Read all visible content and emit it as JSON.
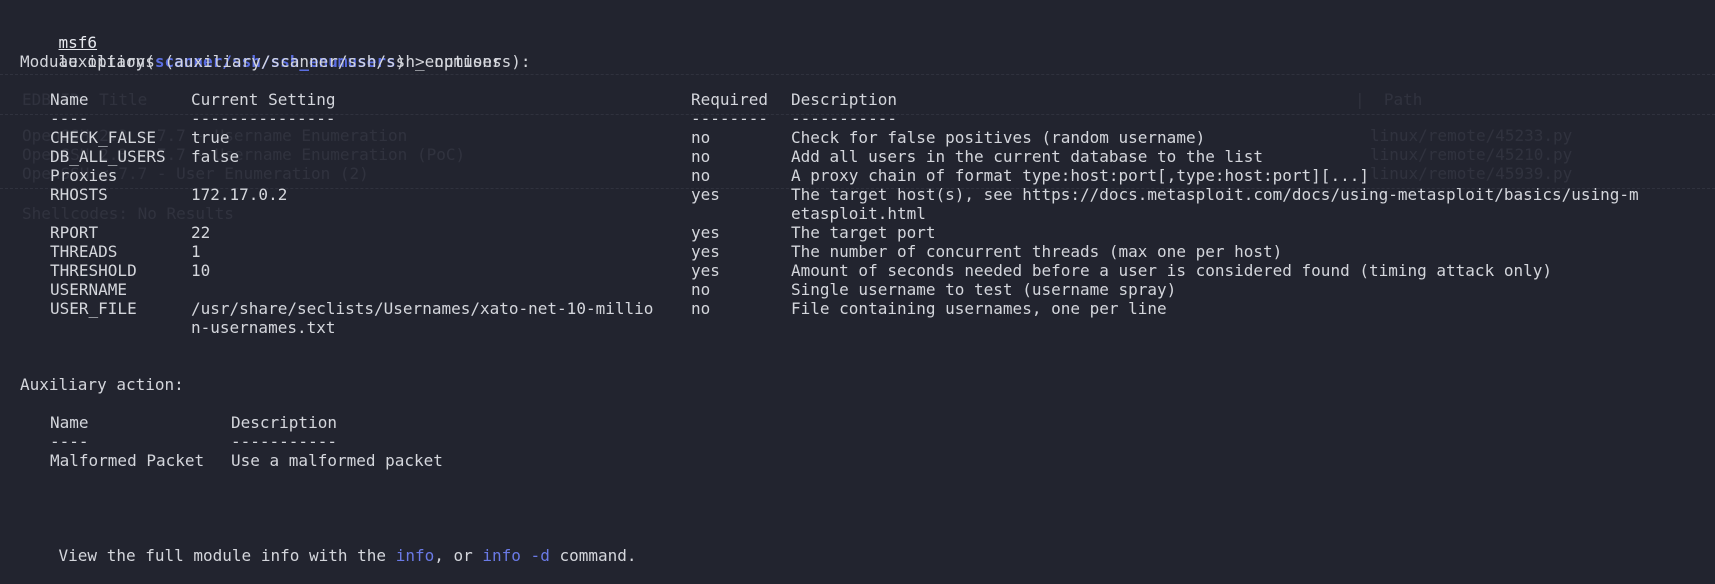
{
  "prompt": {
    "msf": "msf6",
    "module_type": "auxiliary",
    "open_paren": "(",
    "module_path": "scanner/ssh/ssh_enumusers",
    "close": ") > ",
    "command": "options"
  },
  "module_options": {
    "heading": "Module options (auxiliary/scanner/ssh/ssh_enumusers):",
    "headers": {
      "name": "Name",
      "setting": "Current Setting",
      "required": "Required",
      "description": "Description"
    },
    "underlines": {
      "name": "----",
      "setting": "---------------",
      "required": "--------",
      "description": "-----------"
    },
    "rows": [
      {
        "name": "CHECK_FALSE",
        "setting": "true",
        "required": "no",
        "description": "Check for false positives (random username)"
      },
      {
        "name": "DB_ALL_USERS",
        "setting": "false",
        "required": "no",
        "description": "Add all users in the current database to the list"
      },
      {
        "name": "Proxies",
        "setting": "",
        "required": "no",
        "description": "A proxy chain of format type:host:port[,type:host:port][...]"
      },
      {
        "name": "RHOSTS",
        "setting": "172.17.0.2",
        "required": "yes",
        "description": "The target host(s), see https://docs.metasploit.com/docs/using-metasploit/basics/using-m",
        "description_cont": "etasploit.html"
      },
      {
        "name": "RPORT",
        "setting": "22",
        "required": "yes",
        "description": "The target port"
      },
      {
        "name": "THREADS",
        "setting": "1",
        "required": "yes",
        "description": "The number of concurrent threads (max one per host)"
      },
      {
        "name": "THRESHOLD",
        "setting": "10",
        "required": "yes",
        "description": "Amount of seconds needed before a user is considered found (timing attack only)"
      },
      {
        "name": "USERNAME",
        "setting": "",
        "required": "no",
        "description": "Single username to test (username spray)"
      },
      {
        "name": "USER_FILE",
        "setting": "/usr/share/seclists/Usernames/xato-net-10-millio",
        "setting_cont": "n-usernames.txt",
        "required": "no",
        "description": "File containing usernames, one per line"
      }
    ]
  },
  "auxiliary_action": {
    "heading": "Auxiliary action:",
    "headers": {
      "name": "Name",
      "description": "Description"
    },
    "underlines": {
      "name": "----",
      "description": "-----------"
    },
    "rows": [
      {
        "name": "Malformed Packet",
        "description": "Use a malformed packet"
      }
    ]
  },
  "footer": {
    "pre": "View the full module info with the ",
    "info": "info",
    "mid": ", or ",
    "info_d": "info -d",
    "post": " command."
  },
  "ghost_text": {
    "header_title": "EDB-ID  Title",
    "header_path": "|  Path",
    "row1_title": "OpenSSH 2.3 < 7.7 - Username Enumeration",
    "row1_path": "linux/remote/45233.py",
    "row2_title": "OpenSSH 2.3 < 7.7 - Username Enumeration (PoC)",
    "row2_path": "linux/remote/45210.py",
    "row3_title": "OpenSSH < 7.7 - User Enumeration (2)",
    "row3_path": "linux/remote/45939.py",
    "shellcodes": "Shellcodes: No Results"
  },
  "colors": {
    "background": "#22242f",
    "text": "#d4d6dc",
    "accent": "#5b6ee1",
    "link": "#6a7ae6"
  }
}
